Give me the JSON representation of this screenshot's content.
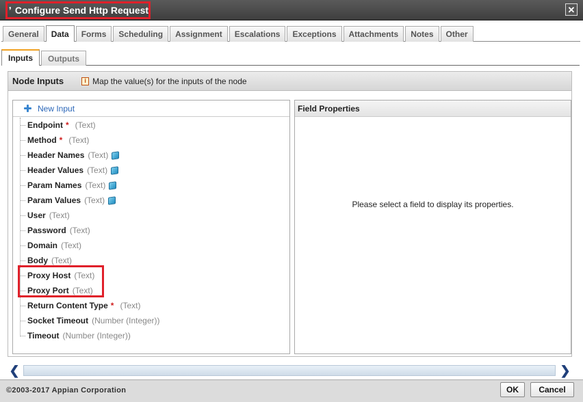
{
  "window": {
    "title": "Configure Send Http Request",
    "close_label": "✕"
  },
  "tabs": [
    {
      "label": "General",
      "active": false
    },
    {
      "label": "Data",
      "active": true
    },
    {
      "label": "Forms",
      "active": false
    },
    {
      "label": "Scheduling",
      "active": false
    },
    {
      "label": "Assignment",
      "active": false
    },
    {
      "label": "Escalations",
      "active": false
    },
    {
      "label": "Exceptions",
      "active": false
    },
    {
      "label": "Attachments",
      "active": false
    },
    {
      "label": "Notes",
      "active": false
    },
    {
      "label": "Other",
      "active": false
    }
  ],
  "subtabs": [
    {
      "label": "Inputs",
      "active": true
    },
    {
      "label": "Outputs",
      "active": false
    }
  ],
  "panel": {
    "title": "Node Inputs",
    "info_icon": "i",
    "hint": "Map the value(s) for the inputs of the node"
  },
  "tree": {
    "new_input_label": "New Input",
    "items": [
      {
        "name": "Endpoint",
        "required": "*",
        "type": "(Text)",
        "multi": false
      },
      {
        "name": "Method",
        "required": "*",
        "type": "(Text)",
        "multi": false
      },
      {
        "name": "Header Names",
        "required": "",
        "type": "(Text)",
        "multi": true
      },
      {
        "name": "Header Values",
        "required": "",
        "type": "(Text)",
        "multi": true
      },
      {
        "name": "Param Names",
        "required": "",
        "type": "(Text)",
        "multi": true
      },
      {
        "name": "Param Values",
        "required": "",
        "type": "(Text)",
        "multi": true
      },
      {
        "name": "User",
        "required": "",
        "type": "(Text)",
        "multi": false
      },
      {
        "name": "Password",
        "required": "",
        "type": "(Text)",
        "multi": false
      },
      {
        "name": "Domain",
        "required": "",
        "type": "(Text)",
        "multi": false
      },
      {
        "name": "Body",
        "required": "",
        "type": "(Text)",
        "multi": false
      },
      {
        "name": "Proxy Host",
        "required": "",
        "type": "(Text)",
        "multi": false
      },
      {
        "name": "Proxy Port",
        "required": "",
        "type": "(Text)",
        "multi": false
      },
      {
        "name": "Return Content Type",
        "required": "*",
        "type": "(Text)",
        "multi": false
      },
      {
        "name": "Socket Timeout",
        "required": "",
        "type": "(Number (Integer))",
        "multi": false
      },
      {
        "name": "Timeout",
        "required": "",
        "type": "(Number (Integer))",
        "multi": false
      }
    ]
  },
  "properties": {
    "title": "Field Properties",
    "empty_message": "Please select a field to display its properties."
  },
  "footer": {
    "copyright": "©2003-2017 Appian Corporation",
    "ok_label": "OK",
    "cancel_label": "Cancel"
  },
  "colors": {
    "highlight": "#e0202a",
    "titlebar": "#4a4a4a",
    "link": "#2a66b8",
    "required": "#d02020"
  },
  "icons": {
    "title": "document-icon",
    "close": "close-icon",
    "info": "info-icon",
    "new_input": "plus-icon",
    "multi": "multiple-values-icon",
    "scroll_left": "chevron-left-icon",
    "scroll_right": "chevron-right-icon"
  }
}
